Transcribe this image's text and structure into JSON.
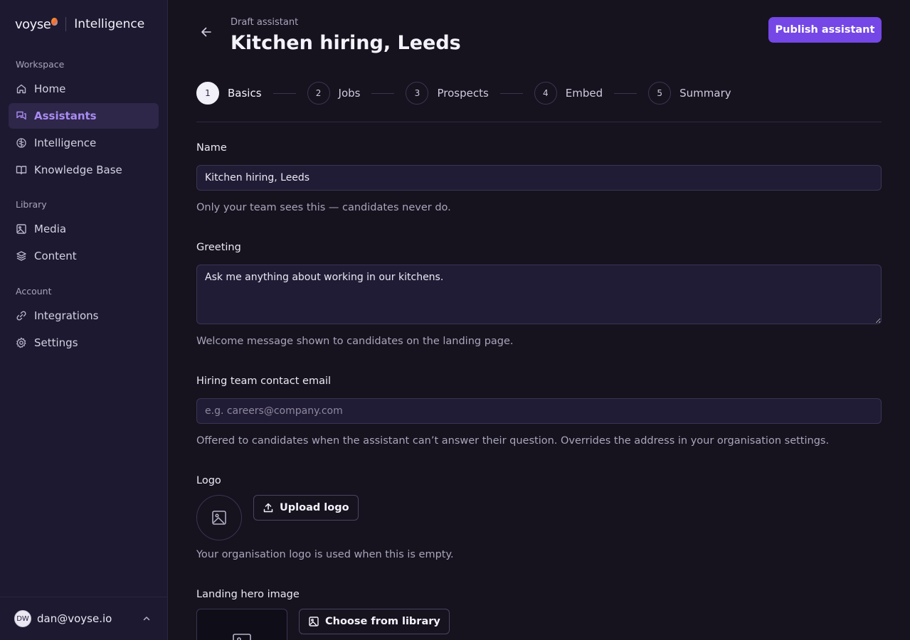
{
  "brand": {
    "logo_text": "voyse",
    "product": "Intelligence"
  },
  "sidebar": {
    "groups": [
      {
        "heading": "Workspace",
        "items": [
          {
            "label": "Home",
            "icon": "home-icon"
          },
          {
            "label": "Assistants",
            "icon": "chat-icon",
            "active": true
          },
          {
            "label": "Intelligence",
            "icon": "brain-icon"
          },
          {
            "label": "Knowledge Base",
            "icon": "book-icon"
          }
        ]
      },
      {
        "heading": "Library",
        "items": [
          {
            "label": "Media",
            "icon": "image-icon"
          },
          {
            "label": "Content",
            "icon": "layers-icon"
          }
        ]
      },
      {
        "heading": "Account",
        "items": [
          {
            "label": "Integrations",
            "icon": "link-icon"
          },
          {
            "label": "Settings",
            "icon": "gear-icon"
          }
        ]
      }
    ],
    "user": {
      "initials": "DW",
      "email": "dan@voyse.io"
    }
  },
  "header": {
    "eyebrow": "Draft assistant",
    "title": "Kitchen hiring, Leeds",
    "publish_label": "Publish assistant"
  },
  "steps": [
    {
      "num": "1",
      "label": "Basics",
      "active": true
    },
    {
      "num": "2",
      "label": "Jobs"
    },
    {
      "num": "3",
      "label": "Prospects"
    },
    {
      "num": "4",
      "label": "Embed"
    },
    {
      "num": "5",
      "label": "Summary"
    }
  ],
  "form": {
    "name": {
      "label": "Name",
      "value": "Kitchen hiring, Leeds",
      "help": "Only your team sees this — candidates never do."
    },
    "greeting": {
      "label": "Greeting",
      "value": "Ask me anything about working in our kitchens.",
      "help": "Welcome message shown to candidates on the landing page."
    },
    "email": {
      "label": "Hiring team contact email",
      "value": "",
      "placeholder": "e.g. careers@company.com",
      "help": "Offered to candidates when the assistant can’t answer their question. Overrides the address in your organisation settings."
    },
    "logo": {
      "label": "Logo",
      "button": "Upload logo",
      "help": "Your organisation logo is used when this is empty."
    },
    "hero": {
      "label": "Landing hero image",
      "button": "Choose from library"
    }
  },
  "colors": {
    "accent": "#7447e6",
    "active_nav": "#a98bf2",
    "background": "#16131f",
    "sidebar": "#1d1930"
  }
}
